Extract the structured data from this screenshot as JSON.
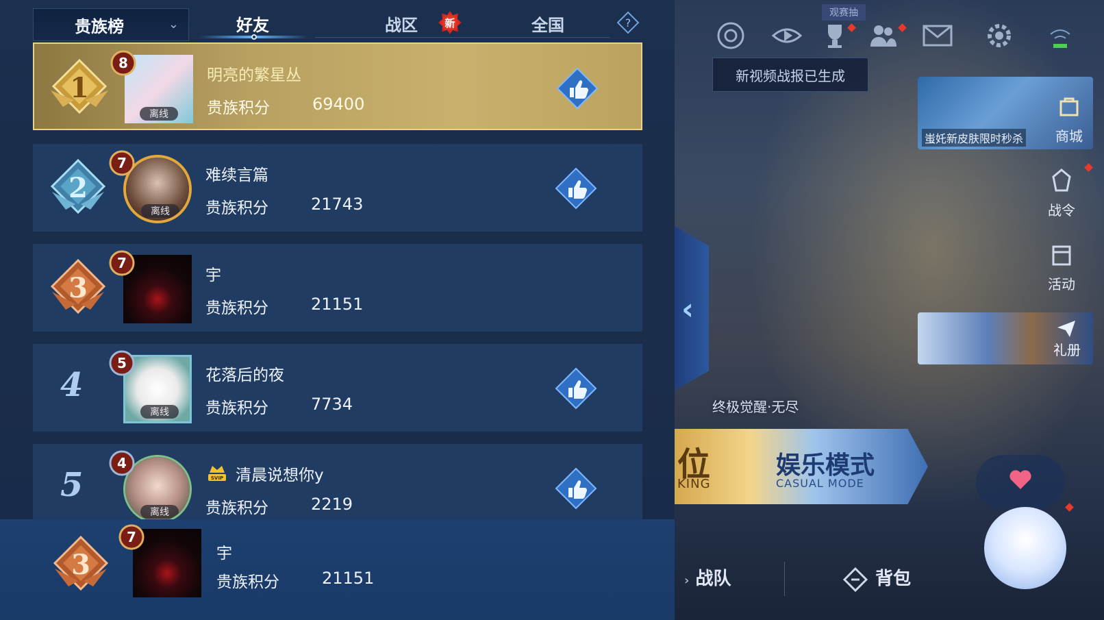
{
  "header": {
    "dropdown_label": "贵族榜",
    "tabs": [
      {
        "label": "好友",
        "active": true
      },
      {
        "label": "战区",
        "badge": "新"
      },
      {
        "label": "全国"
      }
    ]
  },
  "rows": [
    {
      "rank": "1",
      "level": "8",
      "name": "明亮的繁星丛",
      "score_label": "贵族积分",
      "score": "69400",
      "status": "离线",
      "like": true
    },
    {
      "rank": "2",
      "level": "7",
      "name": "难续言篇",
      "score_label": "贵族积分",
      "score": "21743",
      "status": "离线",
      "like": true
    },
    {
      "rank": "3",
      "level": "7",
      "name": "宇",
      "score_label": "贵族积分",
      "score": "21151",
      "like": false
    },
    {
      "rank": "4",
      "level": "5",
      "name": "花落后的夜",
      "score_label": "贵族积分",
      "score": "7734",
      "status": "离线",
      "like": true
    },
    {
      "rank": "5",
      "level": "4",
      "name": "清晨说想你y",
      "score_label": "贵族积分",
      "score": "2219",
      "status": "离线",
      "svip": "SVIP",
      "like": true
    }
  ],
  "self_row": {
    "rank": "3",
    "level": "7",
    "name": "宇",
    "score_label": "贵族积分",
    "score": "21151"
  },
  "right": {
    "match_tag": "观赛抽",
    "notification": "新视频战报已生成",
    "shop": {
      "promo": "蚩奼新皮肤限时秒杀",
      "label": "商城"
    },
    "battle_pass_label": "战令",
    "activity_label": "活动",
    "gift_label": "礼册",
    "event_caption": "终极觉醒·无尽",
    "mode": {
      "left_title": "位",
      "left_sub": "KING",
      "title": "娱乐模式",
      "subtitle": "CASUAL MODE"
    },
    "nav": {
      "team": "战队",
      "bag": "背包"
    }
  },
  "colors": {
    "gold_row": "#c9b06d",
    "row_bg": "#213c62",
    "accent": "#5fb7ff",
    "red_dot": "#e83a2c"
  }
}
